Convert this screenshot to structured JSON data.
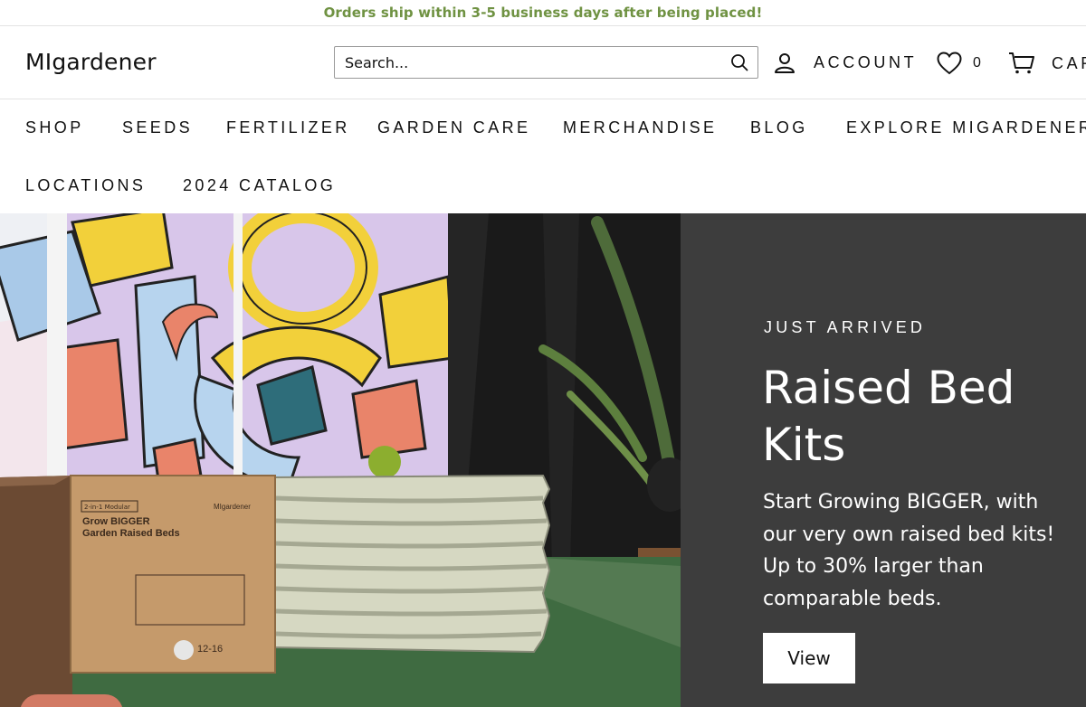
{
  "announcement": "Orders ship within 3-5 business days after being placed!",
  "header": {
    "logo": "MIgardener",
    "search_placeholder": "Search...",
    "account_label": "ACCOUNT",
    "wishlist_count": "0",
    "cart_label": "CART"
  },
  "nav": {
    "items": [
      "SHOP",
      "SEEDS",
      "FERTILIZER",
      "GARDEN CARE",
      "MERCHANDISE",
      "BLOG",
      "EXPLORE MIGARDENER",
      "LOCATIONS",
      "2024 CATALOG"
    ]
  },
  "hero": {
    "eyebrow": "JUST ARRIVED",
    "title": "Raised Bed Kits",
    "description": "Start Growing BIGGER, with our very own raised bed kits! Up to 30% larger than comparable beds.",
    "button_label": "View",
    "box_print": {
      "badge": "2-in-1 Modular",
      "line1": "Grow BIGGER",
      "line2": "Garden Raised Beds",
      "brand": "MIgardener",
      "size": "12-16"
    }
  },
  "colors": {
    "announcement_text": "#6f9242",
    "hero_panel": "#3d3d3d"
  },
  "icons": [
    "search-icon",
    "account-icon",
    "heart-icon",
    "cart-icon"
  ]
}
